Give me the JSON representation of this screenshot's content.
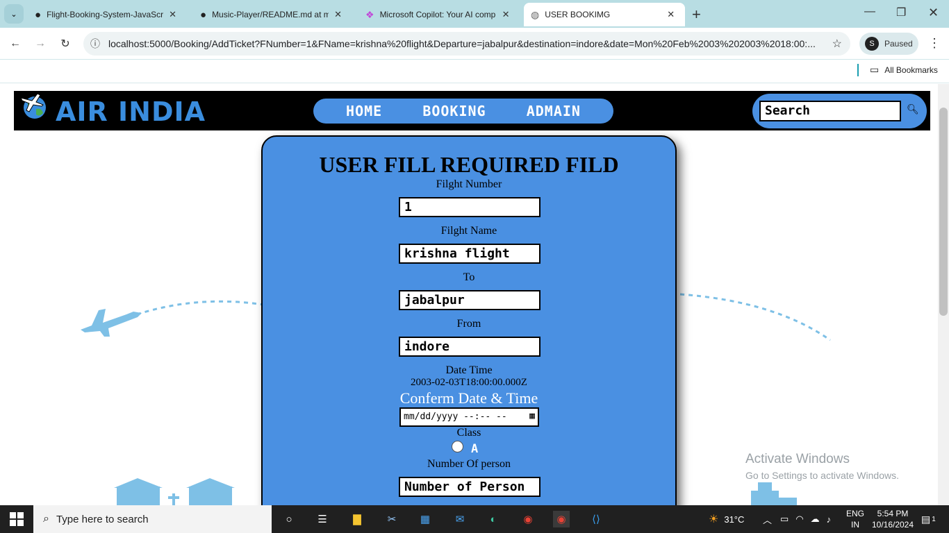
{
  "browser": {
    "tabs": [
      {
        "title": "Flight-Booking-System-JavaScr"
      },
      {
        "title": "Music-Player/README.md at m"
      },
      {
        "title": "Microsoft Copilot: Your AI comp"
      },
      {
        "title": "USER BOOKIMG"
      }
    ],
    "url": "localhost:5000/Booking/AddTicket?FNumber=1&FName=krishna%20flight&Departure=jabalpur&destination=indore&date=Mon%20Feb%2003%202003%2018:00:...",
    "profile_status": "Paused",
    "profile_initial": "S",
    "bookmarks_label": "All Bookmarks"
  },
  "site": {
    "brand": "AIR INDIA",
    "nav": [
      "HOME",
      "BOOKING",
      "ADMAIN"
    ],
    "search_value": "Search"
  },
  "form": {
    "heading": "USER FILL REQUIRED FILD",
    "flight_number_label": "Filght Number",
    "flight_number_value": "1",
    "flight_name_label": "Filght Name",
    "flight_name_value": "krishna flight",
    "to_label": "To",
    "to_value": "jabalpur",
    "from_label": "From",
    "from_value": "indore",
    "datetime_label": "Date Time",
    "datetime_value": "2003-02-03T18:00:00.000Z",
    "confirm_label": "Conferm Date & Time",
    "datetime_input_placeholder": "mm/dd/yyyy --:-- --",
    "class_label": "Class",
    "class_option": "A",
    "persons_label": "Number Of person",
    "persons_placeholder": "Number of Person"
  },
  "watermark": {
    "title": "Activate Windows",
    "subtitle": "Go to Settings to activate Windows."
  },
  "taskbar": {
    "search_placeholder": "Type here to search",
    "weather": "31°C",
    "lang": "ENG",
    "region": "IN",
    "time": "5:54 PM",
    "date": "10/16/2024",
    "notifications": "1"
  },
  "colors": {
    "accent": "#4a90e2",
    "brand": "#3a8dde",
    "tabbar": "#b8dde3"
  }
}
